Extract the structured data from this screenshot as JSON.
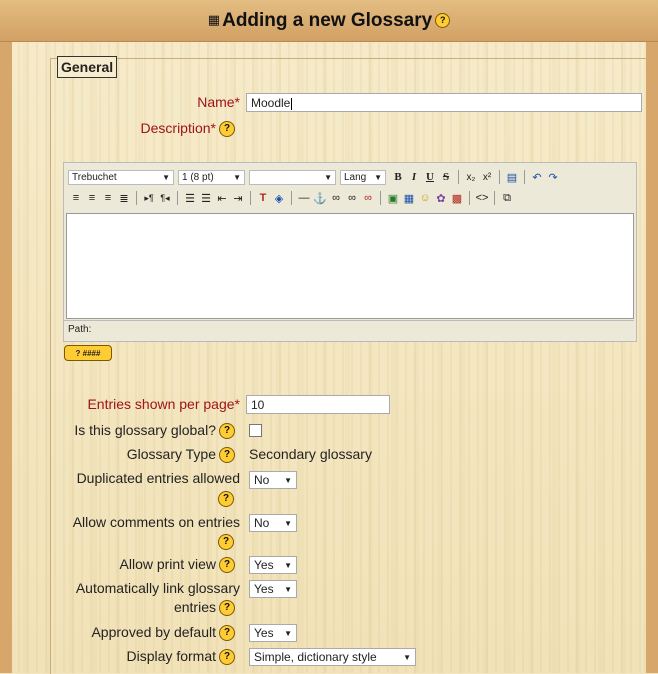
{
  "header": {
    "title": "Adding a new Glossary",
    "help": "?"
  },
  "legend": "General",
  "name": {
    "label": "Name*",
    "value": "Moodle"
  },
  "description": {
    "label": "Description*"
  },
  "editor": {
    "font": "Trebuchet",
    "size": "1 (8 pt)",
    "style": "",
    "lang": "Lang",
    "path_label": "Path:",
    "keyboard_help": "? ####"
  },
  "entries_per_page": {
    "label": "Entries shown per page*",
    "value": "10"
  },
  "is_global": {
    "label": "Is this glossary global?"
  },
  "glossary_type": {
    "label": "Glossary Type",
    "value": "Secondary glossary"
  },
  "duplicated": {
    "label": "Duplicated entries allowed",
    "value": "No"
  },
  "allow_comments": {
    "label": "Allow comments on entries",
    "value": "No"
  },
  "print_view": {
    "label": "Allow print view",
    "value": "Yes"
  },
  "autolink": {
    "label_line1": "Automatically link glossary",
    "label_line2": "entries",
    "value": "Yes"
  },
  "approved": {
    "label": "Approved by default",
    "value": "Yes"
  },
  "display_format": {
    "label": "Display format",
    "value": "Simple, dictionary style"
  },
  "help_glyph": "?"
}
